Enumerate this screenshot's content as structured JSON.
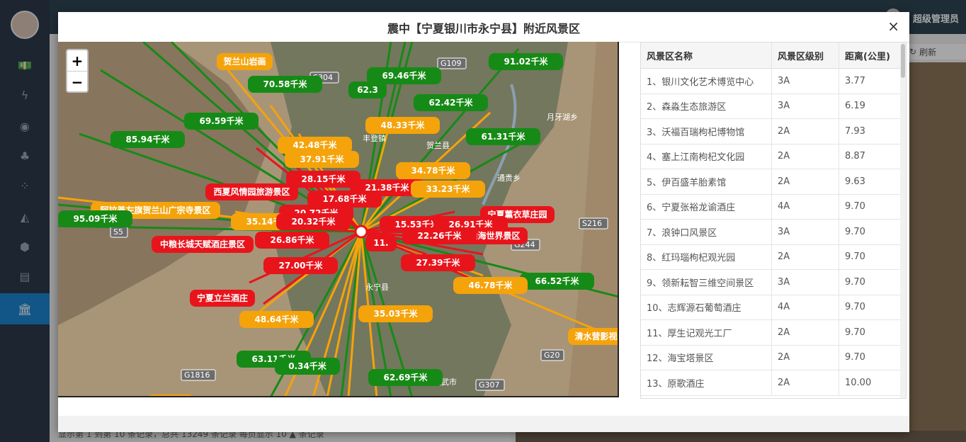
{
  "app": {
    "user_name": "超级管理员",
    "refresh_label": "刷新",
    "footer_text": "显示第 1 到第 10 条记录，总共 13249 条记录 每页显示 10 ▲ 条记录"
  },
  "sidebar": {
    "items": [
      {
        "icon": "money-icon"
      },
      {
        "icon": "bolt-icon"
      },
      {
        "icon": "target-icon"
      },
      {
        "icon": "tree-icon"
      },
      {
        "icon": "grid-icon"
      },
      {
        "icon": "area-chart-icon"
      },
      {
        "icon": "cube-icon"
      },
      {
        "icon": "newspaper-icon"
      },
      {
        "icon": "bank-icon"
      }
    ],
    "glyphs": [
      "💵",
      "ϟ",
      "◉",
      "♣",
      "⁘",
      "◭",
      "⬢",
      "▤",
      "🏛"
    ]
  },
  "modal": {
    "title": "震中【宁夏银川市永宁县】附近风景区",
    "close_label": "×"
  },
  "map": {
    "zoom_in": "+",
    "zoom_out": "−",
    "colors": {
      "red": "#e8141c",
      "orange": "#f5a30a",
      "green": "#168a16"
    },
    "labels": [
      {
        "text": "贺兰山岩画",
        "color": "orange"
      },
      {
        "text": "70.58千米",
        "color": "green"
      },
      {
        "text": "69.46千米",
        "color": "green"
      },
      {
        "text": "91.02千米",
        "color": "green"
      },
      {
        "text": "62.3",
        "color": "green"
      },
      {
        "text": "62.42千米",
        "color": "green"
      },
      {
        "text": "69.59千米",
        "color": "green"
      },
      {
        "text": "48.33千米",
        "color": "orange"
      },
      {
        "text": "61.31千米",
        "color": "green"
      },
      {
        "text": "85.94千米",
        "color": "green"
      },
      {
        "text": "42.48千米",
        "color": "orange"
      },
      {
        "text": "37.91千米",
        "color": "orange"
      },
      {
        "text": "28.15千米",
        "color": "red"
      },
      {
        "text": "34.78千米",
        "color": "orange"
      },
      {
        "text": "21.38千米",
        "color": "red"
      },
      {
        "text": "33.23千米",
        "color": "orange"
      },
      {
        "text": "西夏风情园旅游景区",
        "color": "red"
      },
      {
        "text": "17.68千米",
        "color": "red"
      },
      {
        "text": "阿拉善左旗贺兰山广宗寺景区",
        "color": "orange"
      },
      {
        "text": "20.72千米",
        "color": "red"
      },
      {
        "text": "宁夏薰衣草庄园",
        "color": "red"
      },
      {
        "text": "95.09千米",
        "color": "green"
      },
      {
        "text": "35.14千米",
        "color": "orange"
      },
      {
        "text": "20.32千米",
        "color": "red"
      },
      {
        "text": "15.53千米",
        "color": "red"
      },
      {
        "text": "26.91千米",
        "color": "red"
      },
      {
        "text": "天山海世界景区",
        "color": "red"
      },
      {
        "text": "22.26千米",
        "color": "red"
      },
      {
        "text": "中粮长城天赋酒庄景区",
        "color": "red"
      },
      {
        "text": "26.86千米",
        "color": "red"
      },
      {
        "text": "11.",
        "color": "red"
      },
      {
        "text": "27.39千米",
        "color": "red"
      },
      {
        "text": "27.00千米",
        "color": "red"
      },
      {
        "text": "66.52千米",
        "color": "green"
      },
      {
        "text": "46.78千米",
        "color": "orange"
      },
      {
        "text": "宁夏立兰酒庄",
        "color": "red"
      },
      {
        "text": "35.03千米",
        "color": "orange"
      },
      {
        "text": "48.64千米",
        "color": "orange"
      },
      {
        "text": "清水营影视",
        "color": "orange"
      },
      {
        "text": "63.11千米",
        "color": "green"
      },
      {
        "text": "0.34千米",
        "color": "green"
      },
      {
        "text": "62.69千米",
        "color": "green"
      },
      {
        "text": "西夏酒庄",
        "color": "orange"
      }
    ],
    "road_labels": [
      "S304",
      "G109",
      "S5",
      "G244",
      "G20",
      "G1816",
      "G307",
      "S216",
      "丰登镇",
      "贺兰县",
      "通贵乡",
      "月牙湖乡",
      "永宁县",
      "灵武市"
    ]
  },
  "table": {
    "headers": [
      "风景区名称",
      "风景区级别",
      "距离(公里)"
    ],
    "rows": [
      [
        "1、银川文化艺术博览中心",
        "3A",
        "3.77"
      ],
      [
        "2、森淼生态旅游区",
        "3A",
        "6.19"
      ],
      [
        "3、沃福百瑞枸杞博物馆",
        "2A",
        "7.93"
      ],
      [
        "4、塞上江南枸杞文化园",
        "2A",
        "8.87"
      ],
      [
        "5、伊百盛羊胎素馆",
        "2A",
        "9.63"
      ],
      [
        "6、宁夏张裕龙谕酒庄",
        "4A",
        "9.70"
      ],
      [
        "7、浪钟口风景区",
        "3A",
        "9.70"
      ],
      [
        "8、红玛瑙枸杞观光园",
        "2A",
        "9.70"
      ],
      [
        "9、领新耘智三维空间景区",
        "3A",
        "9.70"
      ],
      [
        "10、志辉源石葡萄酒庄",
        "4A",
        "9.70"
      ],
      [
        "11、厚生记观光工厂",
        "2A",
        "9.70"
      ],
      [
        "12、海宝塔景区",
        "2A",
        "9.70"
      ],
      [
        "13、原歌酒庄",
        "2A",
        "10.00"
      ]
    ]
  }
}
